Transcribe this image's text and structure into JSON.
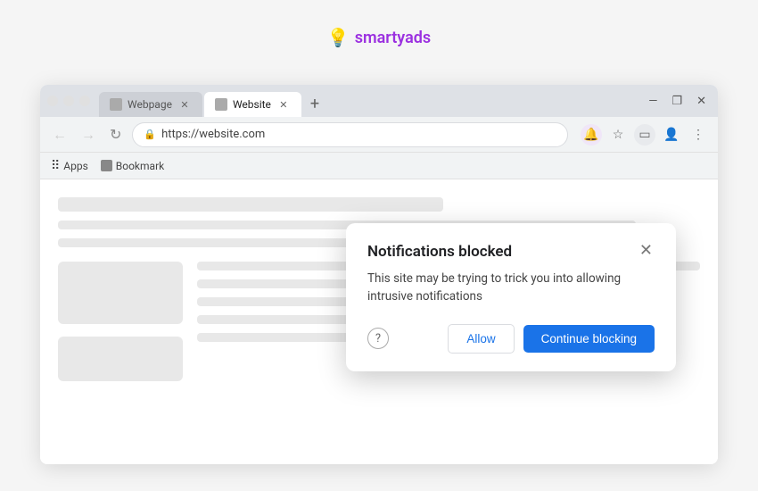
{
  "logo": {
    "icon": "💡",
    "text_before": "smarty",
    "text_after": "ads"
  },
  "browser": {
    "tabs": [
      {
        "label": "Webpage",
        "active": false
      },
      {
        "label": "Website",
        "active": true
      }
    ],
    "address": "https://website.com",
    "bookmarks": [
      {
        "label": "Apps"
      },
      {
        "label": "Bookmark"
      }
    ],
    "window_min": "—",
    "window_max": "❐",
    "window_close": "✕"
  },
  "popup": {
    "title": "Notifications blocked",
    "body": "This site may be trying to trick you into allowing intrusive notifications",
    "close_icon": "✕",
    "help_icon": "?",
    "allow_label": "Allow",
    "continue_label": "Continue blocking"
  }
}
